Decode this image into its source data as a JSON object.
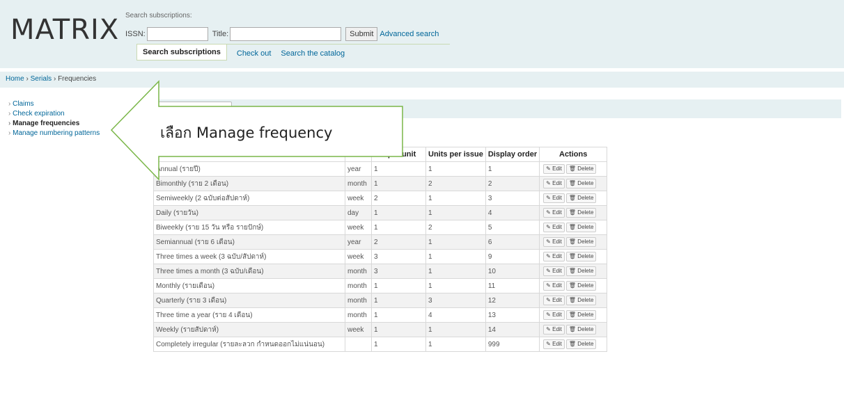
{
  "app": {
    "logo": "MATRIX"
  },
  "search": {
    "caption": "Search subscriptions:",
    "issn_label": "ISSN:",
    "issn_value": "",
    "title_label": "Title:",
    "title_value": "",
    "submit_label": "Submit",
    "advanced_label": "Advanced search"
  },
  "tabs": [
    {
      "label": "Search subscriptions"
    },
    {
      "label": "Check out"
    },
    {
      "label": "Search the catalog"
    }
  ],
  "breadcrumb": {
    "home": "Home",
    "serials": "Serials",
    "current": "Frequencies",
    "separator": "›"
  },
  "sidebar": {
    "items": [
      {
        "label": "Claims"
      },
      {
        "label": "Check expiration"
      },
      {
        "label": "Manage frequencies"
      },
      {
        "label": "Manage numbering patterns"
      }
    ]
  },
  "callout": {
    "text": "เลือก Manage frequency"
  },
  "table": {
    "headers": [
      "s per unit",
      "Units per issue",
      "Display order",
      "Actions"
    ],
    "edit_label": "Edit",
    "delete_label": "Delete",
    "edit_icon": "pencil-icon",
    "delete_icon": "trash-icon",
    "rows": [
      {
        "description": "Annual (รายปี)",
        "unit": "year",
        "issues_per_unit": "1",
        "units_per_issue": "1",
        "display_order": "1"
      },
      {
        "description": "Bimonthly (ราย 2 เดือน)",
        "unit": "month",
        "issues_per_unit": "1",
        "units_per_issue": "2",
        "display_order": "2"
      },
      {
        "description": "Semiweekly (2 ฉบับต่อสัปดาห์)",
        "unit": "week",
        "issues_per_unit": "2",
        "units_per_issue": "1",
        "display_order": "3"
      },
      {
        "description": "Daily (รายวัน)",
        "unit": "day",
        "issues_per_unit": "1",
        "units_per_issue": "1",
        "display_order": "4"
      },
      {
        "description": "Biweekly (ราย 15 วัน หรือ รายปักษ์)",
        "unit": "week",
        "issues_per_unit": "1",
        "units_per_issue": "2",
        "display_order": "5"
      },
      {
        "description": "Semiannual (ราย 6 เดือน)",
        "unit": "year",
        "issues_per_unit": "2",
        "units_per_issue": "1",
        "display_order": "6"
      },
      {
        "description": "Three times a week (3 ฉบับ/สัปดาห์)",
        "unit": "week",
        "issues_per_unit": "3",
        "units_per_issue": "1",
        "display_order": "9"
      },
      {
        "description": "Three times a month (3 ฉบับ/เดือน)",
        "unit": "month",
        "issues_per_unit": "3",
        "units_per_issue": "1",
        "display_order": "10"
      },
      {
        "description": "Monthly (รายเดือน)",
        "unit": "month",
        "issues_per_unit": "1",
        "units_per_issue": "1",
        "display_order": "11"
      },
      {
        "description": "Quarterly (ราย 3 เดือน)",
        "unit": "month",
        "issues_per_unit": "1",
        "units_per_issue": "3",
        "display_order": "12"
      },
      {
        "description": "Three time a year (ราย 4 เดือน)",
        "unit": "month",
        "issues_per_unit": "1",
        "units_per_issue": "4",
        "display_order": "13"
      },
      {
        "description": "Weekly (รายสัปดาห์)",
        "unit": "week",
        "issues_per_unit": "1",
        "units_per_issue": "1",
        "display_order": "14"
      },
      {
        "description": "Completely irregular (รายละลวก กำหนดออกไม่แน่นอน)",
        "unit": "",
        "issues_per_unit": "1",
        "units_per_issue": "1",
        "display_order": "999"
      }
    ]
  },
  "colors": {
    "accent_link": "#006699",
    "header_bg": "#e6f0f2",
    "callout_border": "#7ab648"
  }
}
